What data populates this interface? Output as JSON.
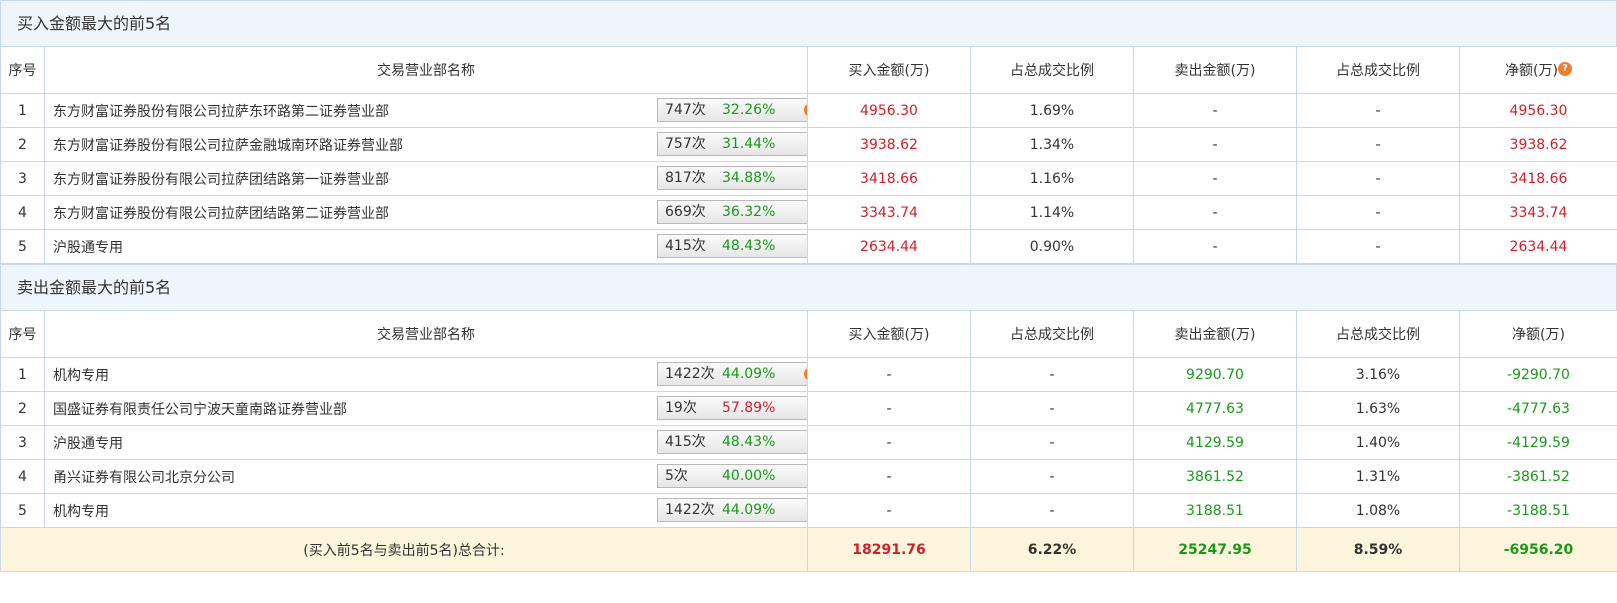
{
  "buy_section": {
    "title": "买入金额最大的前5名",
    "headers": {
      "idx": "序号",
      "name": "交易营业部名称",
      "buy": "买入金额(万)",
      "buy_pct": "占总成交比例",
      "sell": "卖出金额(万)",
      "sell_pct": "占总成交比例",
      "net": "净额(万)"
    },
    "rows": [
      {
        "idx": "1",
        "name": "东方财富证券股份有限公司拉萨东环路第二证券营业部",
        "count": "747次",
        "pct": "32.26%",
        "buy": "4956.30",
        "buy_pct": "1.69%",
        "sell": "-",
        "sell_pct": "-",
        "net": "4956.30"
      },
      {
        "idx": "2",
        "name": "东方财富证券股份有限公司拉萨金融城南环路证券营业部",
        "count": "757次",
        "pct": "31.44%",
        "buy": "3938.62",
        "buy_pct": "1.34%",
        "sell": "-",
        "sell_pct": "-",
        "net": "3938.62"
      },
      {
        "idx": "3",
        "name": "东方财富证券股份有限公司拉萨团结路第一证券营业部",
        "count": "817次",
        "pct": "34.88%",
        "buy": "3418.66",
        "buy_pct": "1.16%",
        "sell": "-",
        "sell_pct": "-",
        "net": "3418.66"
      },
      {
        "idx": "4",
        "name": "东方财富证券股份有限公司拉萨团结路第二证券营业部",
        "count": "669次",
        "pct": "36.32%",
        "buy": "3343.74",
        "buy_pct": "1.14%",
        "sell": "-",
        "sell_pct": "-",
        "net": "3343.74"
      },
      {
        "idx": "5",
        "name": "沪股通专用",
        "count": "415次",
        "pct": "48.43%",
        "buy": "2634.44",
        "buy_pct": "0.90%",
        "sell": "-",
        "sell_pct": "-",
        "net": "2634.44"
      }
    ]
  },
  "sell_section": {
    "title": "卖出金额最大的前5名",
    "headers": {
      "idx": "序号",
      "name": "交易营业部名称",
      "buy": "买入金额(万)",
      "buy_pct": "占总成交比例",
      "sell": "卖出金额(万)",
      "sell_pct": "占总成交比例",
      "net": "净额(万)"
    },
    "rows": [
      {
        "idx": "1",
        "name": "机构专用",
        "count": "1422次",
        "pct": "44.09%",
        "buy": "-",
        "buy_pct": "-",
        "sell": "9290.70",
        "sell_pct": "3.16%",
        "net": "-9290.70"
      },
      {
        "idx": "2",
        "name": "国盛证券有限责任公司宁波天童南路证券营业部",
        "count": "19次",
        "pct": "57.89%",
        "buy": "-",
        "buy_pct": "-",
        "sell": "4777.63",
        "sell_pct": "1.63%",
        "net": "-4777.63"
      },
      {
        "idx": "3",
        "name": "沪股通专用",
        "count": "415次",
        "pct": "48.43%",
        "buy": "-",
        "buy_pct": "-",
        "sell": "4129.59",
        "sell_pct": "1.40%",
        "net": "-4129.59"
      },
      {
        "idx": "4",
        "name": "甬兴证券有限公司北京分公司",
        "count": "5次",
        "pct": "40.00%",
        "buy": "-",
        "buy_pct": "-",
        "sell": "3861.52",
        "sell_pct": "1.31%",
        "net": "-3861.52"
      },
      {
        "idx": "5",
        "name": "机构专用",
        "count": "1422次",
        "pct": "44.09%",
        "buy": "-",
        "buy_pct": "-",
        "sell": "3188.51",
        "sell_pct": "1.08%",
        "net": "-3188.51"
      }
    ]
  },
  "total": {
    "label": "(买入前5名与卖出前5名)总合计:",
    "buy": "18291.76",
    "buy_pct": "6.22%",
    "sell": "25247.95",
    "sell_pct": "8.59%",
    "net": "-6956.20"
  },
  "icons": {
    "question": "?",
    "question_icon": "question-circle-icon",
    "arrow_icon": "play-arrow-icon"
  },
  "colors": {
    "positive": "#d0202a",
    "negative": "#1a9a1a",
    "header_bg": "#eef5fc",
    "total_bg": "#fdf6dc",
    "icon_orange": "#f07f2a"
  }
}
